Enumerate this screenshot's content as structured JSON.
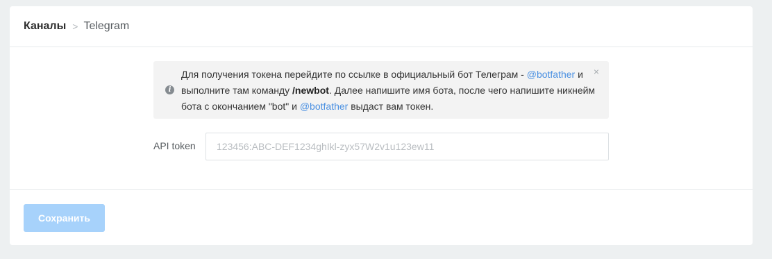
{
  "breadcrumb": {
    "root": "Каналы",
    "separator": ">",
    "current": "Telegram"
  },
  "alert": {
    "icon": "info-icon",
    "text_part1": "Для получения токена перейдите по ссылке в официальный бот Телеграм - ",
    "link1": "@botfather",
    "text_part2": " и выполните там команду ",
    "command": "/newbot",
    "text_part3": ". Далее напишите имя бота, после чего напишите никнейм бота с окончанием \"bot\" и ",
    "link2": "@botfather",
    "text_part4": " выдаст вам токен.",
    "close_icon": "close-icon",
    "close_glyph": "×"
  },
  "form": {
    "api_token_label": "API token",
    "api_token_value": "",
    "api_token_placeholder": "123456:ABC-DEF1234ghIkl-zyx57W2v1u123ew11"
  },
  "footer": {
    "save_label": "Сохранить"
  },
  "colors": {
    "page_bg": "#edf0f1",
    "card_bg": "#ffffff",
    "alert_bg": "#f3f3f3",
    "link": "#4a90e2",
    "save_button_disabled": "#a7d2fb"
  }
}
